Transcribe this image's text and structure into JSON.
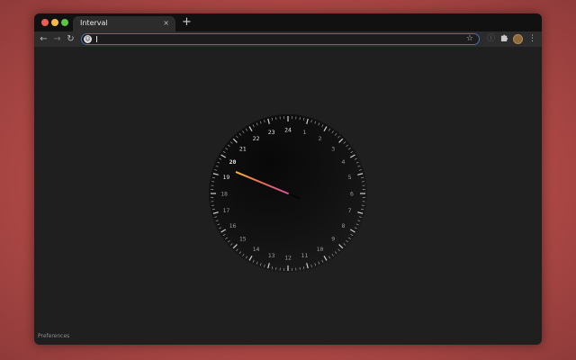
{
  "browser": {
    "tab_title": "Interval",
    "tab_close_glyph": "×",
    "new_tab_glyph": "+",
    "url_value": "",
    "icons": [
      "back-arrow-icon",
      "forward-arrow-icon",
      "reload-icon",
      "site-info-icon",
      "star-icon",
      "info-icon",
      "extensions-puzzle-icon",
      "profile-avatar-icon",
      "menu-kebab-icon"
    ]
  },
  "clock": {
    "hour_labels": [
      "24",
      "1",
      "2",
      "3",
      "4",
      "5",
      "6",
      "7",
      "8",
      "9",
      "10",
      "11",
      "12",
      "13",
      "14",
      "15",
      "16",
      "17",
      "18",
      "19",
      "20",
      "21",
      "22",
      "23"
    ],
    "hand_hour_value": 19.5,
    "hand_colors": [
      "#f4b244",
      "#ea6a5a",
      "#d9509a"
    ]
  },
  "footer": {
    "preferences_label": "Preferences"
  },
  "colors": {
    "backdrop": "#b24a47",
    "window_bg": "#202020",
    "omnibox_border": "#4b6fae"
  }
}
